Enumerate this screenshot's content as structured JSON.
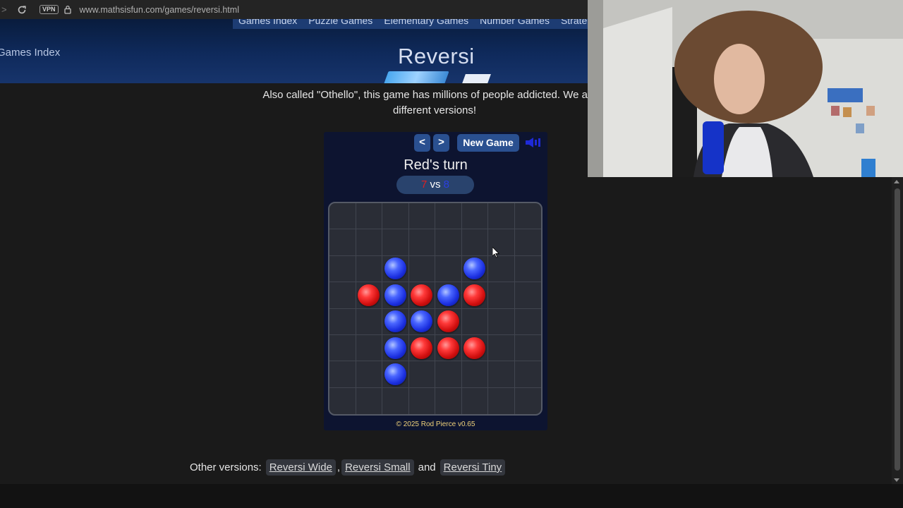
{
  "browser": {
    "url": "www.mathsisfun.com/games/reversi.html",
    "vpn_label": "VPN"
  },
  "site_header": {
    "menu": [
      "Games Index",
      "Puzzle Games",
      "Elementary Games",
      "Number Games",
      "Strate"
    ],
    "games_index_label": "Games Index",
    "title": "Reversi"
  },
  "intro": {
    "line1": "Also called \"Othello\", this game has millions of people addicted. We also l",
    "line2": "different versions!"
  },
  "game": {
    "prev_label": "<",
    "next_label": ">",
    "new_game_label": "New Game",
    "turn_text": "Red's turn",
    "score": {
      "red": "7",
      "vs": "vs",
      "blue": "8"
    },
    "board": [
      [
        null,
        null,
        null,
        null,
        null,
        null,
        null,
        null
      ],
      [
        null,
        null,
        null,
        null,
        null,
        null,
        null,
        null
      ],
      [
        null,
        null,
        "blue",
        null,
        null,
        "blue",
        null,
        null
      ],
      [
        null,
        "red",
        "blue",
        "red",
        "blue",
        "red",
        null,
        null
      ],
      [
        null,
        null,
        "blue",
        "blue",
        "red",
        null,
        null,
        null
      ],
      [
        null,
        null,
        "blue",
        "red",
        "red",
        "red",
        null,
        null
      ],
      [
        null,
        null,
        "blue",
        null,
        null,
        null,
        null,
        null
      ],
      [
        null,
        null,
        null,
        null,
        null,
        null,
        null,
        null
      ]
    ],
    "copyright": "© 2025 Rod Pierce v0.65",
    "colors": {
      "red": "#e02020",
      "blue": "#2a3fe0"
    }
  },
  "other_versions": {
    "label": "Other versions:",
    "links": [
      "Reversi Wide",
      "Reversi Small",
      "Reversi Tiny"
    ],
    "separator": ",",
    "and_text": "and"
  },
  "icons": {
    "reload": "reload-icon",
    "lock": "lock-icon",
    "sound": "speaker-icon",
    "cursor": "mouse-pointer-icon"
  }
}
